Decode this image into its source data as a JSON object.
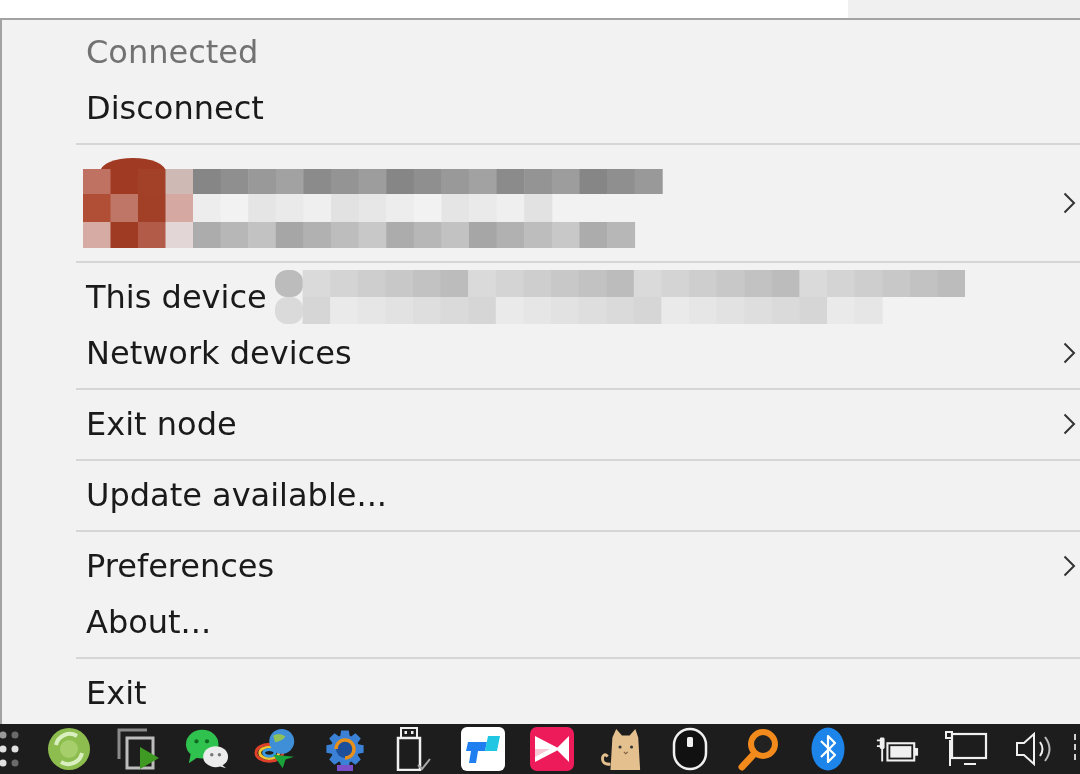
{
  "menu": {
    "groups": [
      {
        "items": [
          {
            "kind": "label",
            "label": "Connected",
            "disabled": true,
            "has_submenu": false,
            "redacted": false
          },
          {
            "kind": "label",
            "label": "Disconnect",
            "disabled": false,
            "has_submenu": false,
            "redacted": false
          }
        ]
      },
      {
        "items": [
          {
            "kind": "account",
            "disabled": false,
            "has_submenu": true
          }
        ]
      },
      {
        "items": [
          {
            "kind": "label",
            "label": "This device",
            "disabled": false,
            "has_submenu": false,
            "redacted": true
          },
          {
            "kind": "label",
            "label": "Network devices",
            "disabled": false,
            "has_submenu": true,
            "redacted": false
          }
        ]
      },
      {
        "items": [
          {
            "kind": "label",
            "label": "Exit node",
            "disabled": false,
            "has_submenu": true,
            "redacted": false
          }
        ]
      },
      {
        "items": [
          {
            "kind": "label",
            "label": "Update available...",
            "disabled": false,
            "has_submenu": false,
            "redacted": false
          }
        ]
      },
      {
        "items": [
          {
            "kind": "label",
            "label": "Preferences",
            "disabled": false,
            "has_submenu": true,
            "redacted": false
          },
          {
            "kind": "label",
            "label": "About...",
            "disabled": false,
            "has_submenu": false,
            "redacted": false
          }
        ]
      },
      {
        "items": [
          {
            "kind": "label",
            "label": "Exit",
            "disabled": false,
            "has_submenu": false,
            "redacted": false
          }
        ]
      }
    ]
  }
}
